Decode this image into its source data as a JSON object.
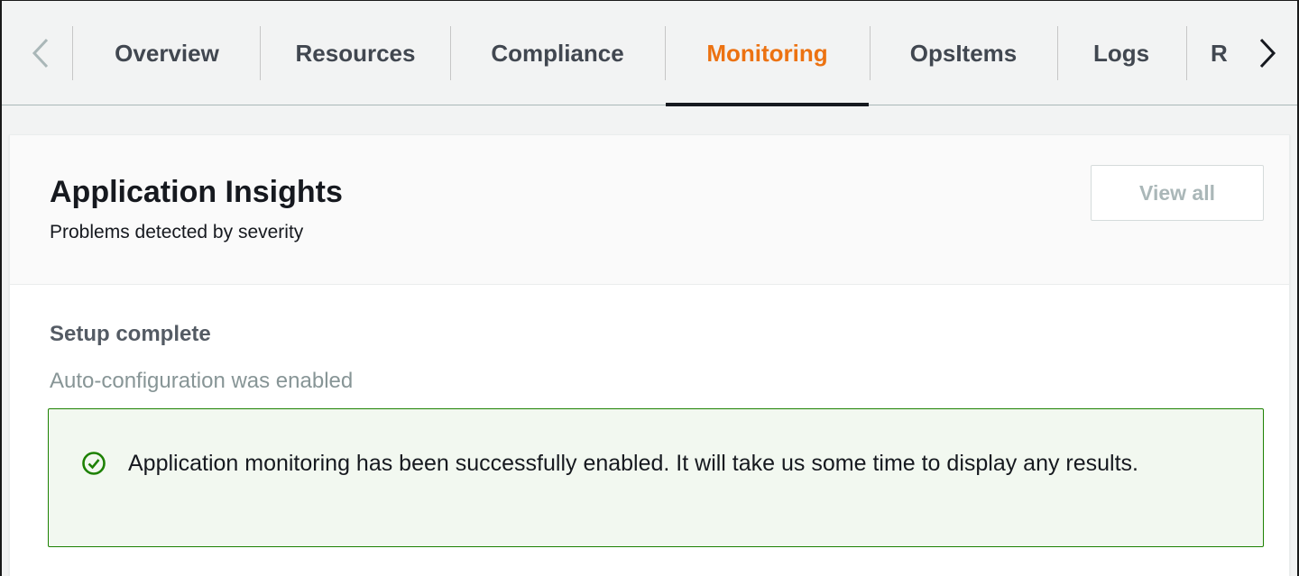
{
  "tabs": {
    "items": [
      {
        "label": "Overview"
      },
      {
        "label": "Resources"
      },
      {
        "label": "Compliance"
      },
      {
        "label": "Monitoring",
        "active": true
      },
      {
        "label": "OpsItems"
      },
      {
        "label": "Logs"
      },
      {
        "label": "R"
      }
    ],
    "prev_icon": "chevron-left-icon",
    "next_icon": "chevron-right-icon",
    "active_color": "#ec7211"
  },
  "panel": {
    "title": "Application Insights",
    "subtitle": "Problems detected by severity",
    "view_all_label": "View all"
  },
  "section": {
    "title": "Setup complete",
    "description": "Auto-configuration was enabled"
  },
  "alert": {
    "type": "success",
    "icon": "check-circle-icon",
    "color": "#1d8102",
    "message": "Application monitoring has been successfully enabled. It will take us some time to display any results."
  }
}
